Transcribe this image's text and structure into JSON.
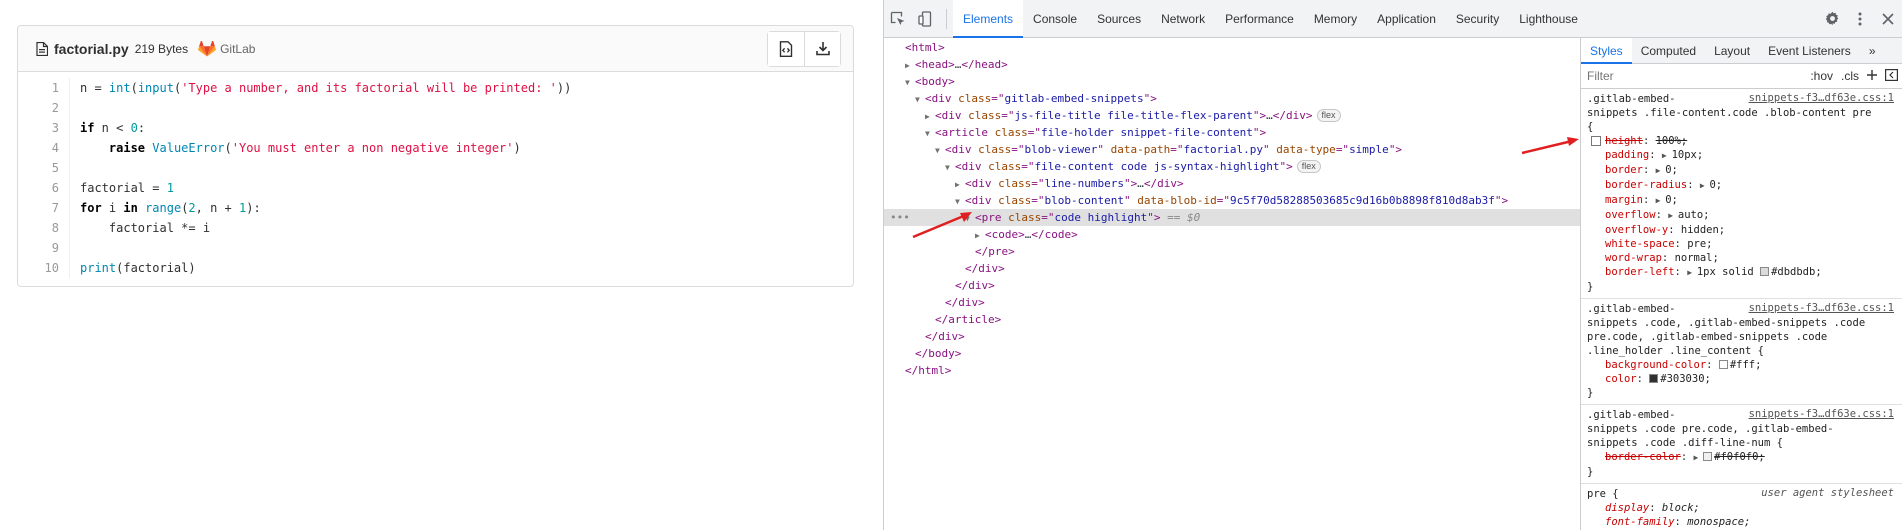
{
  "snippet": {
    "file_name": "factorial.py",
    "file_size": "219 Bytes",
    "source": "GitLab",
    "line_numbers": [
      "1",
      "2",
      "3",
      "4",
      "5",
      "6",
      "7",
      "8",
      "9",
      "10"
    ]
  },
  "devtools": {
    "tabs": [
      "Elements",
      "Console",
      "Sources",
      "Network",
      "Performance",
      "Memory",
      "Application",
      "Security",
      "Lighthouse"
    ],
    "active_tab": "Elements",
    "styles_tabs": [
      "Styles",
      "Computed",
      "Layout",
      "Event Listeners"
    ],
    "active_styles_tab": "Styles",
    "filter_placeholder": "Filter",
    "hov_label": ":hov",
    "cls_label": ".cls",
    "more_tabs": "»",
    "dom_badge_flex": "flex",
    "selected_suffix": "== $0",
    "ellipsis": "…",
    "dots": "•••"
  },
  "colors": {
    "accent": "#1a73e8",
    "border": "#dbdbdb",
    "code_bg": "#fff",
    "code_text": "#303030",
    "border_color_swatch": "#f0f0f0",
    "arrow_red": "#e02020"
  }
}
